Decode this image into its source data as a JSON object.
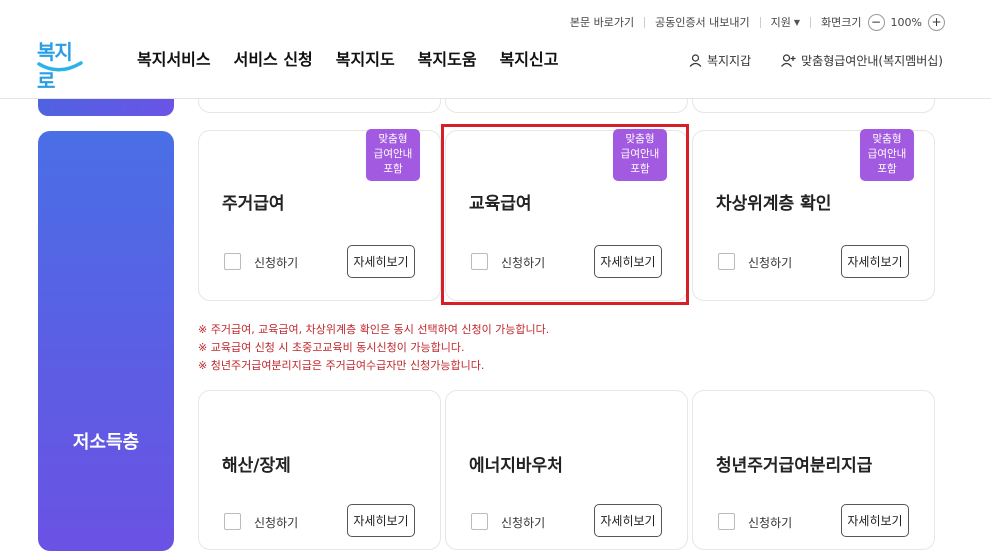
{
  "util": {
    "skip_link": "본문 바로가기",
    "cert_export": "공동인증서 내보내기",
    "support": "지원",
    "zoom_label": "화면크기",
    "zoom_minus": "−",
    "zoom_value": "100%",
    "zoom_plus": "+"
  },
  "logo": {
    "text": "복지로"
  },
  "gnb": [
    "복지서비스",
    "서비스 신청",
    "복지지도",
    "복지도움",
    "복지신고"
  ],
  "user_links": {
    "wallet": "복지지갑",
    "membership": "맞춤형급여안내(복지멤버십)"
  },
  "category": {
    "label": "저소득층"
  },
  "badge_text": [
    "맞춤형",
    "급여안내",
    "포함"
  ],
  "cards_row1": [
    {
      "title": "주거급여",
      "check_label": "신청하기",
      "detail": "자세히보기"
    },
    {
      "title": "교육급여",
      "check_label": "신청하기",
      "detail": "자세히보기"
    },
    {
      "title": "차상위계층 확인",
      "check_label": "신청하기",
      "detail": "자세히보기"
    }
  ],
  "cards_row2": [
    {
      "title": "해산/장제",
      "check_label": "신청하기",
      "detail": "자세히보기"
    },
    {
      "title": "에너지바우처",
      "check_label": "신청하기",
      "detail": "자세히보기"
    },
    {
      "title": "청년주거급여분리지급",
      "check_label": "신청하기",
      "detail": "자세히보기"
    }
  ],
  "notes": [
    "※ 주거급여, 교육급여, 차상위계층 확인은 동시 선택하여 신청이 가능합니다.",
    "※ 교육급여 신청 시 초중고교육비 동시신청이 가능합니다.",
    "※ 청년주거급여분리지급은 주거급여수급자만 신청가능합니다."
  ],
  "colors": {
    "brand_blue": "#2a9ee5",
    "category_gradient_start": "#4a6fe6",
    "category_gradient_end": "#6b52e4",
    "badge_purple": "#a25be0",
    "note_red": "#c0262b",
    "highlight_red": "#d61f26"
  }
}
